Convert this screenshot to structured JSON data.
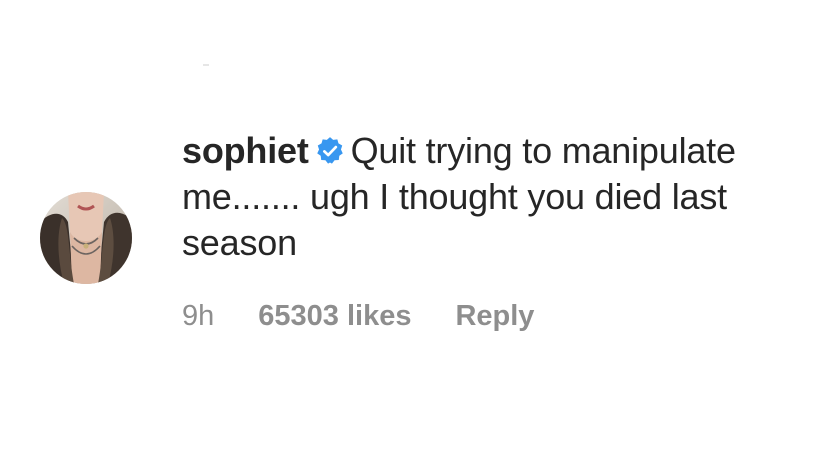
{
  "comment": {
    "username": "sophiet",
    "verified_icon": "verified-badge-icon",
    "text": "Quit trying to manipulate me....... ugh I thought you died last season",
    "time": "9h",
    "likes": "65303 likes",
    "reply_label": "Reply"
  },
  "colors": {
    "text": "#262626",
    "muted": "#8e8e8e",
    "verified": "#3897f0"
  }
}
